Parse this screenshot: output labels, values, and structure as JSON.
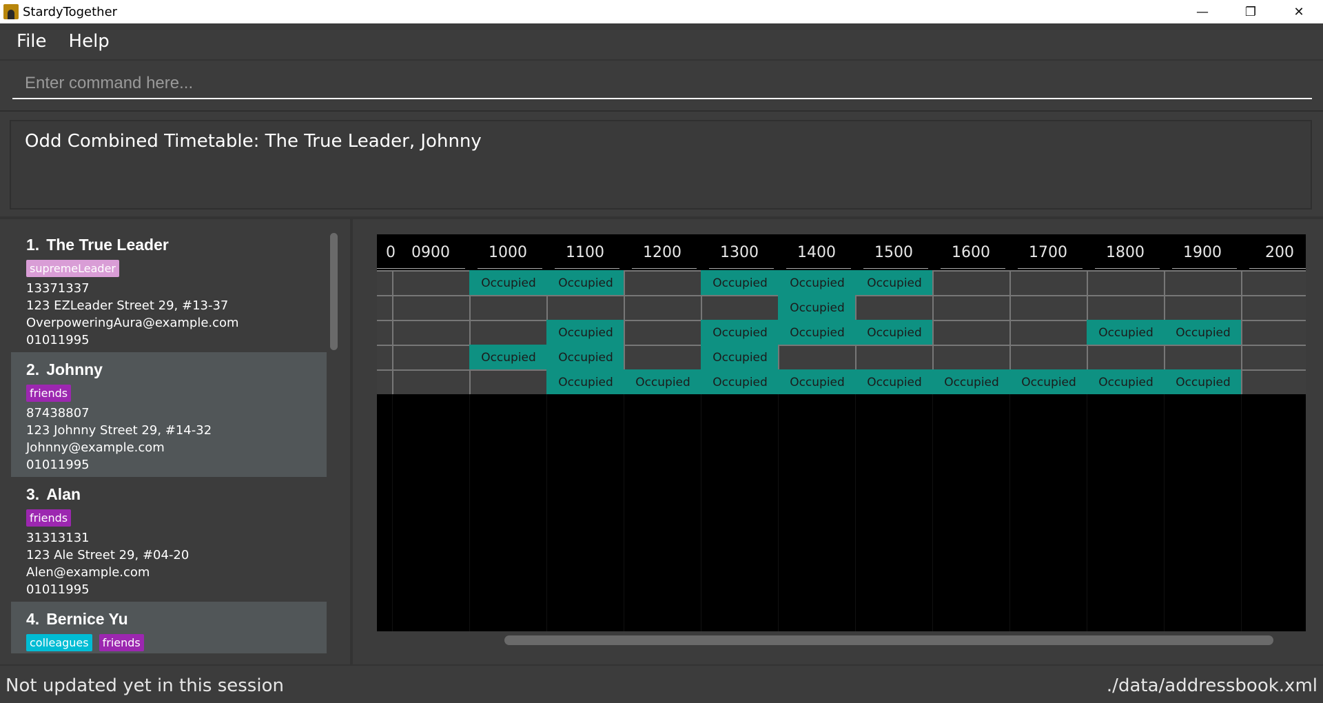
{
  "window": {
    "title": "StardyTogether",
    "minimize_glyph": "—",
    "restore_glyph": "❐",
    "close_glyph": "✕"
  },
  "menu": [
    "File",
    "Help"
  ],
  "command": {
    "placeholder": "Enter command here..."
  },
  "result": {
    "text": "Odd Combined Timetable: The True Leader, Johnny"
  },
  "persons": [
    {
      "index": "1.",
      "name": "The True Leader",
      "tags": [
        {
          "label": "supremeLeader",
          "color": "#d99dd6"
        }
      ],
      "phone": "13371337",
      "address": "123 EZLeader Street 29, #13-37",
      "email": "OverpoweringAura@example.com",
      "birthday": "01011995"
    },
    {
      "index": "2.",
      "name": "Johnny",
      "tags": [
        {
          "label": "friends",
          "color": "#9c27b0"
        }
      ],
      "phone": "87438807",
      "address": "123 Johnny Street 29, #14-32",
      "email": "Johnny@example.com",
      "birthday": "01011995"
    },
    {
      "index": "3.",
      "name": "Alan",
      "tags": [
        {
          "label": "friends",
          "color": "#9c27b0"
        }
      ],
      "phone": "31313131",
      "address": "123 Ale Street 29, #04-20",
      "email": "Alen@example.com",
      "birthday": "01011995"
    },
    {
      "index": "4.",
      "name": "Bernice Yu",
      "tags": [
        {
          "label": "colleagues",
          "color": "#00bcd4"
        },
        {
          "label": "friends",
          "color": "#9c27b0"
        }
      ],
      "phone": "",
      "address": "",
      "email": "",
      "birthday": ""
    }
  ],
  "timetable": {
    "headers": [
      "0",
      "0900",
      "1000",
      "1100",
      "1200",
      "1300",
      "1400",
      "1500",
      "1600",
      "1700",
      "1800",
      "1900",
      "200"
    ],
    "occupied_label": "Occupied",
    "rows": [
      [
        0,
        0,
        1,
        1,
        0,
        1,
        1,
        1,
        0,
        0,
        0,
        0,
        0
      ],
      [
        0,
        0,
        0,
        0,
        0,
        0,
        1,
        0,
        0,
        0,
        0,
        0,
        0
      ],
      [
        0,
        0,
        0,
        1,
        0,
        1,
        1,
        1,
        0,
        0,
        1,
        1,
        0
      ],
      [
        0,
        0,
        1,
        1,
        0,
        1,
        0,
        0,
        0,
        0,
        0,
        0,
        0
      ],
      [
        0,
        0,
        0,
        1,
        1,
        1,
        1,
        1,
        1,
        1,
        1,
        1,
        0
      ]
    ],
    "occupied_color": "#0e9182"
  },
  "status": {
    "left": "Not updated yet in this session",
    "right": "./data/addressbook.xml"
  }
}
